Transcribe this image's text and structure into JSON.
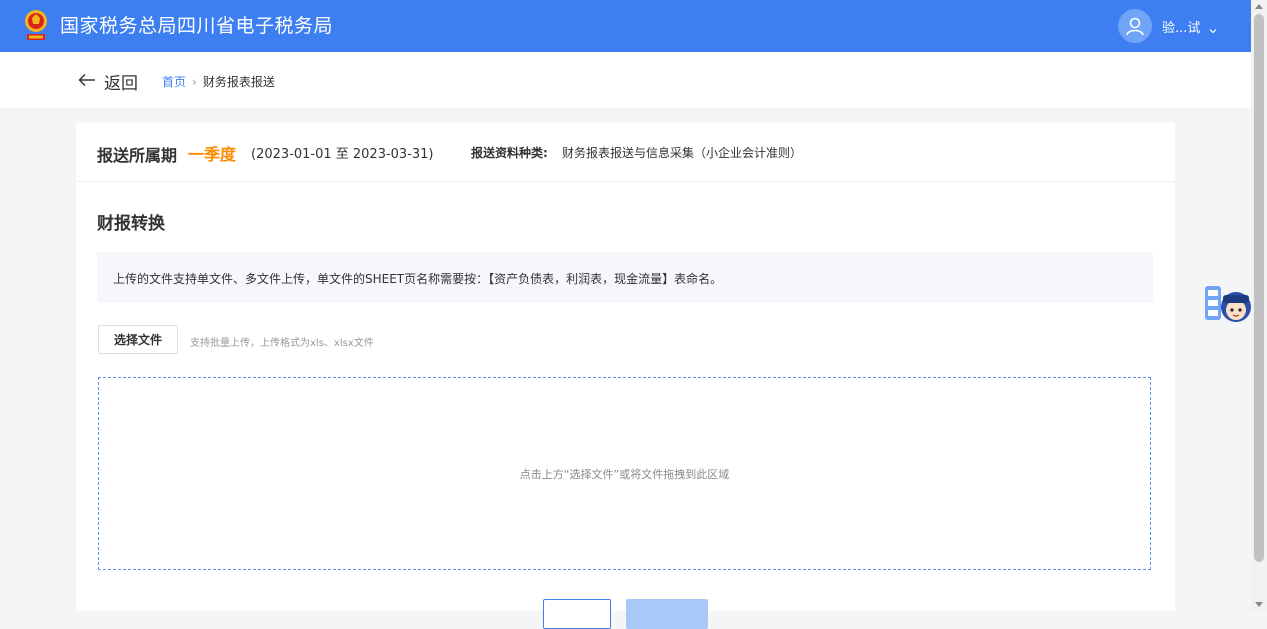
{
  "header": {
    "title": "国家税务总局四川省电子税务局",
    "user_name": "验...试",
    "logo_icon": "tax-emblem-icon",
    "avatar_icon": "user-avatar-icon",
    "caret_icon": "chevron-down-icon",
    "background_color": "#3d7ff0"
  },
  "nav": {
    "back_label": "返回",
    "breadcrumb": {
      "home": "首页",
      "separator": "›",
      "current": "财务报表报送"
    }
  },
  "period": {
    "label": "报送所属期",
    "value": "一季度",
    "range": "(2023-01-01 至 2023-03-31)",
    "type_label": "报送资料种类:",
    "type_value": "财务报表报送与信息采集（小企业会计准则）"
  },
  "section": {
    "title": "财报转换",
    "notice": "上传的文件支持单文件、多文件上传，单文件的SHEET页名称需要按：【资产负债表，利润表，现金流量】表命名。"
  },
  "upload": {
    "button_label": "选择文件",
    "hint": "支持批量上传，上传格式为xls、xlsx文件",
    "dropzone_text": "点击上方“选择文件”或将文件拖拽到此区域"
  },
  "footer_buttons": {
    "prev_label": "",
    "next_label": ""
  },
  "assistant": {
    "icon": "tax-assistant-icon"
  },
  "colors": {
    "accent": "#3d7ff0",
    "highlight": "#ff8a00"
  }
}
